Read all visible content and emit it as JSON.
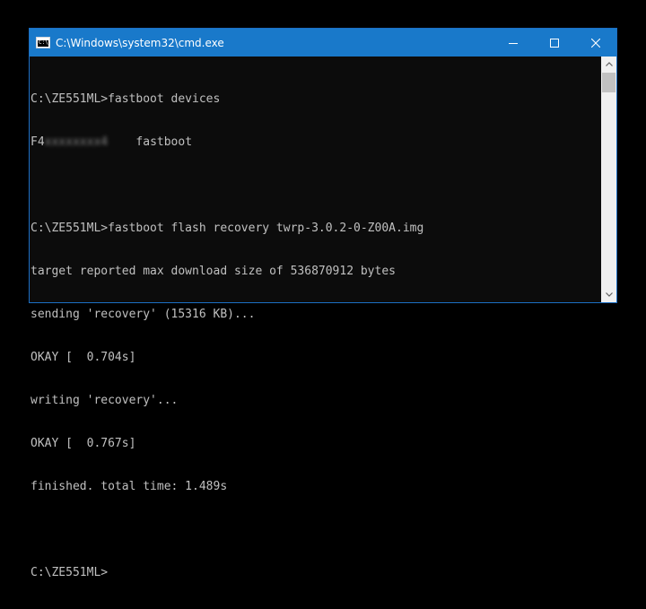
{
  "window": {
    "title": "C:\\Windows\\system32\\cmd.exe",
    "icon": "cmd-icon",
    "icon_text": "C:\\"
  },
  "controls": {
    "minimize_icon": "minimize-icon",
    "maximize_icon": "maximize-icon",
    "close_icon": "close-icon"
  },
  "console": {
    "lines": [
      "C:\\ZE551ML>fastboot devices",
      "",
      "",
      "C:\\ZE551ML>fastboot flash recovery twrp-3.0.2-0-Z00A.img",
      "target reported max download size of 536870912 bytes",
      "sending 'recovery' (15316 KB)...",
      "OKAY [  0.704s]",
      "writing 'recovery'...",
      "OKAY [  0.767s]",
      "finished. total time: 1.489s",
      "",
      "C:\\ZE551ML>"
    ],
    "device_prefix": "F4",
    "device_serial_obscured": "xxxxxxxx4",
    "device_mode": "    fastboot"
  },
  "colors": {
    "titlebar": "#1979ca",
    "console_bg": "#0c0c0c",
    "console_text": "#c0c0c0"
  }
}
